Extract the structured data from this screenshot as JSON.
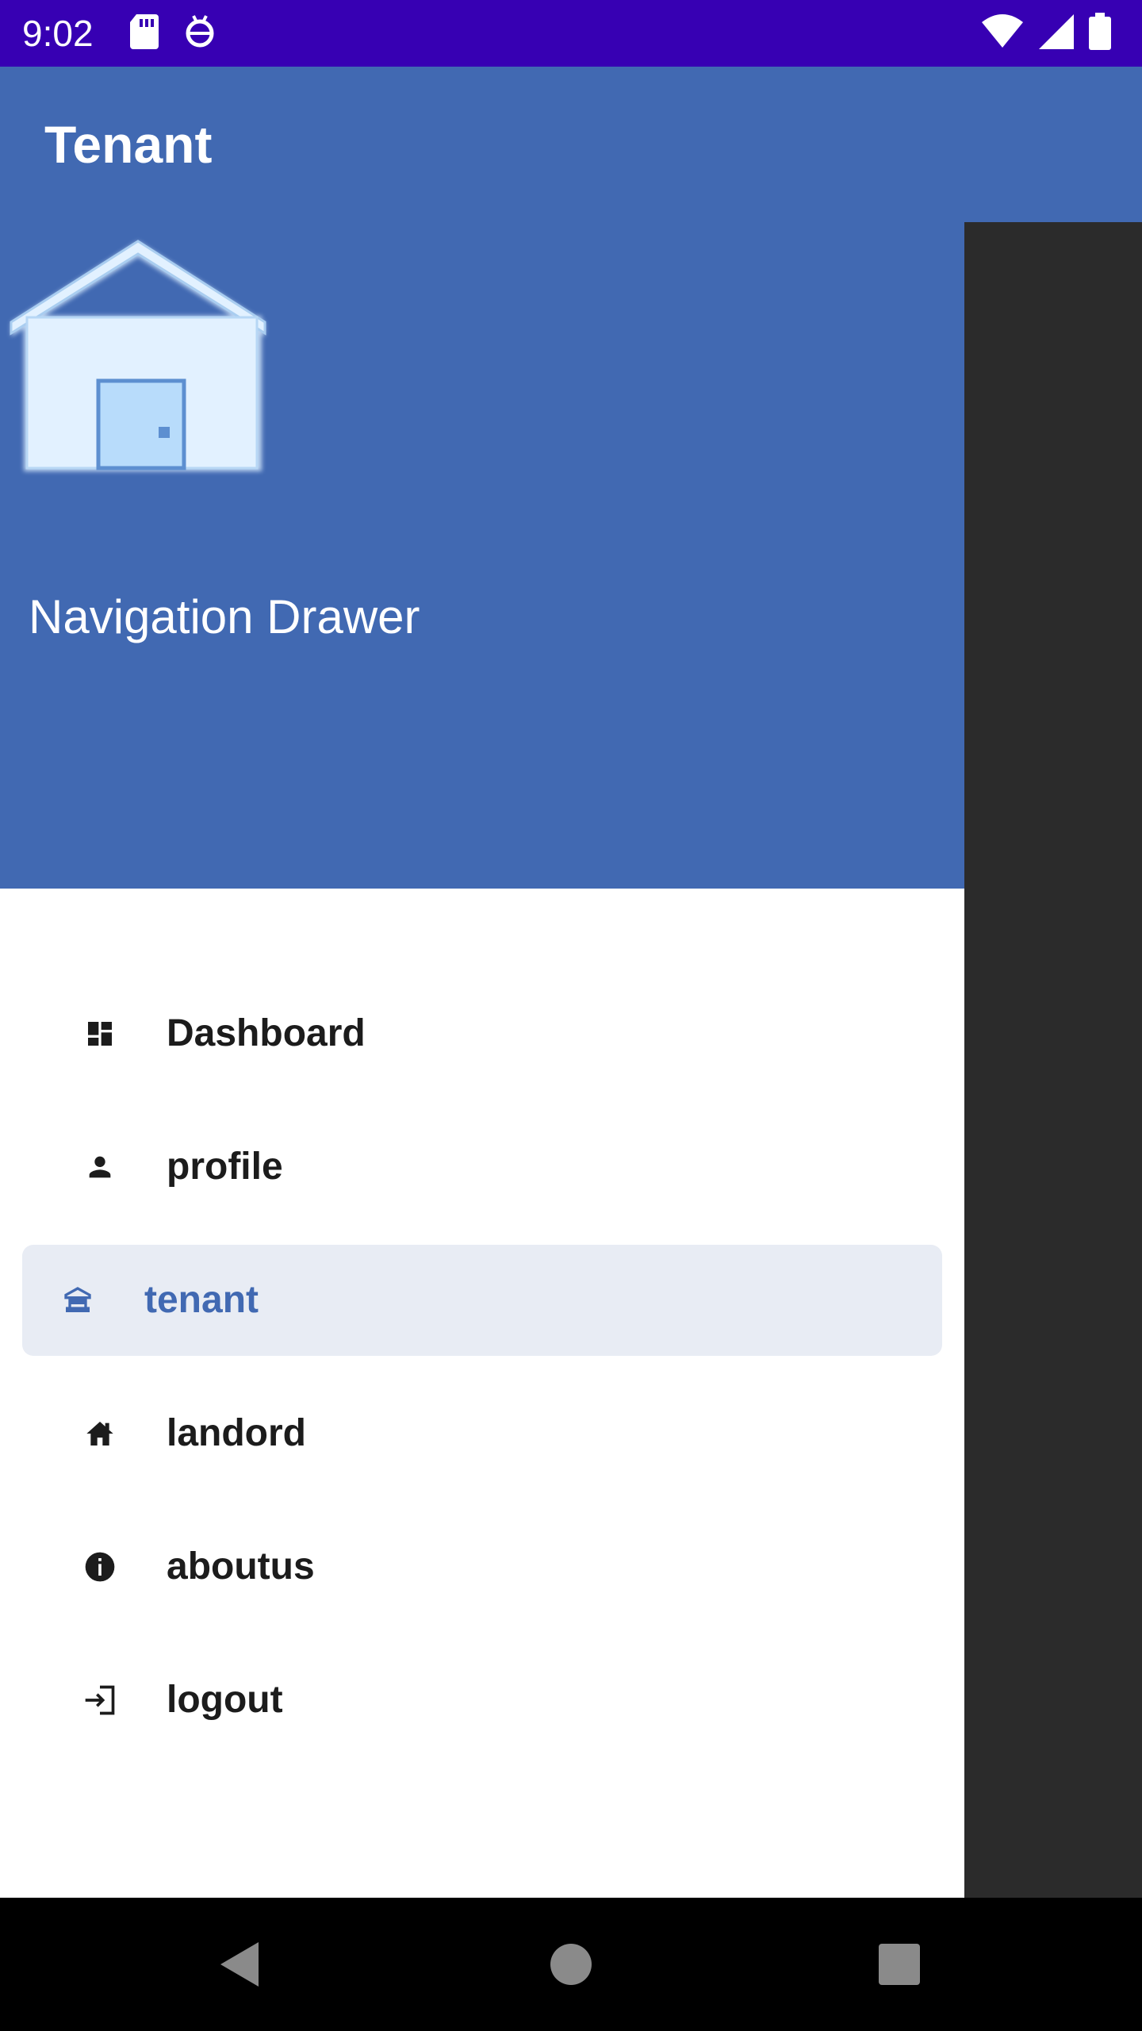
{
  "status_bar": {
    "time": "9:02",
    "left_icons": [
      "sd-card-icon",
      "debug-icon"
    ],
    "right_icons": [
      "wifi-icon",
      "signal-icon",
      "battery-icon"
    ],
    "background": "#3700b3"
  },
  "app_bar": {
    "title": "Tenant",
    "background": "#4169b2"
  },
  "drawer": {
    "header": {
      "logo_icon": "house-icon",
      "title": "Navigation Drawer",
      "background": "#4169b2"
    },
    "items": [
      {
        "label": "Dashboard",
        "icon": "dashboard-icon",
        "selected": false
      },
      {
        "label": "profile",
        "icon": "person-icon",
        "selected": false
      },
      {
        "label": "tenant",
        "icon": "tenant-icon",
        "selected": true
      },
      {
        "label": "landord",
        "icon": "home-icon",
        "selected": false
      },
      {
        "label": "aboutus",
        "icon": "info-icon",
        "selected": false
      },
      {
        "label": "logout",
        "icon": "logout-icon",
        "selected": false
      }
    ],
    "selected_background": "#e8ecf4",
    "selected_text_color": "#4169b2"
  },
  "nav_bar": {
    "buttons": [
      "back-icon",
      "home-circle-icon",
      "recents-icon"
    ]
  }
}
